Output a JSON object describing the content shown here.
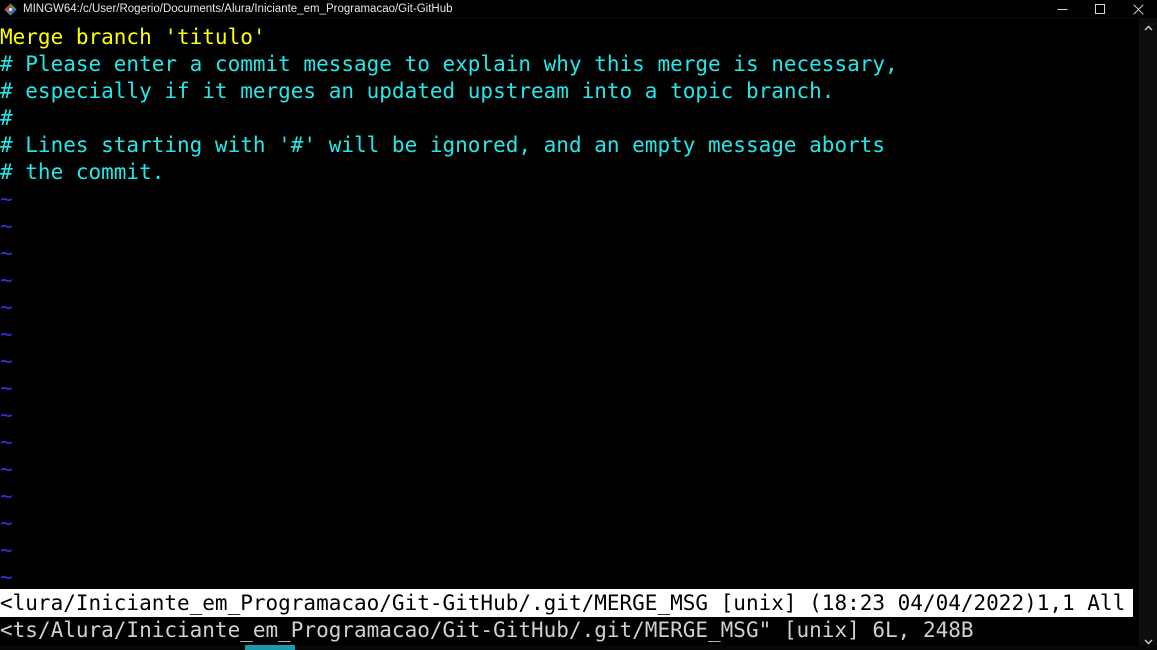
{
  "window": {
    "title": "MINGW64:/c/User/Rogerio/Documents/Alura/Iniciante_em_Programacao/Git-GitHub",
    "icon": "git-bash-icon",
    "controls": {
      "minimize": "minimize-icon",
      "maximize": "restore-icon",
      "close": "close-icon"
    }
  },
  "editor": {
    "lines": [
      {
        "text": "Merge branch 'titulo'",
        "color": "#ffff00",
        "kind": "commit-summary"
      },
      {
        "text": "# Please enter a commit message to explain why this merge is necessary,",
        "color": "#24e8e8",
        "kind": "comment"
      },
      {
        "text": "# especially if it merges an updated upstream into a topic branch.",
        "color": "#24e8e8",
        "kind": "comment"
      },
      {
        "text": "#",
        "color": "#24e8e8",
        "kind": "comment"
      },
      {
        "text": "# Lines starting with '#' will be ignored, and an empty message aborts",
        "color": "#24e8e8",
        "kind": "comment"
      },
      {
        "text": "# the commit.",
        "color": "#24e8e8",
        "kind": "comment"
      },
      {
        "text": "~",
        "color": "#3333dd",
        "kind": "filler"
      },
      {
        "text": "~",
        "color": "#3333dd",
        "kind": "filler"
      },
      {
        "text": "~",
        "color": "#3333dd",
        "kind": "filler"
      },
      {
        "text": "~",
        "color": "#3333dd",
        "kind": "filler"
      },
      {
        "text": "~",
        "color": "#3333dd",
        "kind": "filler"
      },
      {
        "text": "~",
        "color": "#3333dd",
        "kind": "filler"
      },
      {
        "text": "~",
        "color": "#3333dd",
        "kind": "filler"
      },
      {
        "text": "~",
        "color": "#3333dd",
        "kind": "filler"
      },
      {
        "text": "~",
        "color": "#3333dd",
        "kind": "filler"
      },
      {
        "text": "~",
        "color": "#3333dd",
        "kind": "filler"
      },
      {
        "text": "~",
        "color": "#3333dd",
        "kind": "filler"
      },
      {
        "text": "~",
        "color": "#3333dd",
        "kind": "filler"
      },
      {
        "text": "~",
        "color": "#3333dd",
        "kind": "filler"
      },
      {
        "text": "~",
        "color": "#3333dd",
        "kind": "filler"
      },
      {
        "text": "~",
        "color": "#3333dd",
        "kind": "filler"
      }
    ],
    "status_line": "<lura/Iniciante_em_Programacao/Git-GitHub/.git/MERGE_MSG [unix] (18:23 04/04/2022)1,1 All",
    "command_line": "<ts/Alura/Iniciante_em_Programacao/Git-GitHub/.git/MERGE_MSG\" [unix] 6L, 248B",
    "status_detail": {
      "file_path": "<lura/Iniciante_em_Programacao/Git-GitHub/.git/MERGE_MSG",
      "file_format": "[unix]",
      "timestamp": "(18:23 04/04/2022)",
      "cursor_position": "1,1",
      "scroll_position": "All"
    },
    "command_detail": {
      "file_path": "<ts/Alura/Iniciante_em_Programacao/Git-GitHub/.git/MERGE_MSG\"",
      "file_format": "[unix]",
      "line_count": "6L",
      "byte_size": "248B"
    }
  },
  "scrollbars": {
    "vertical": {
      "up_arrow": "chevron-up-icon",
      "down_arrow": "chevron-down-icon"
    },
    "horizontal": {
      "thumb_color": "#1b9aa8"
    }
  }
}
